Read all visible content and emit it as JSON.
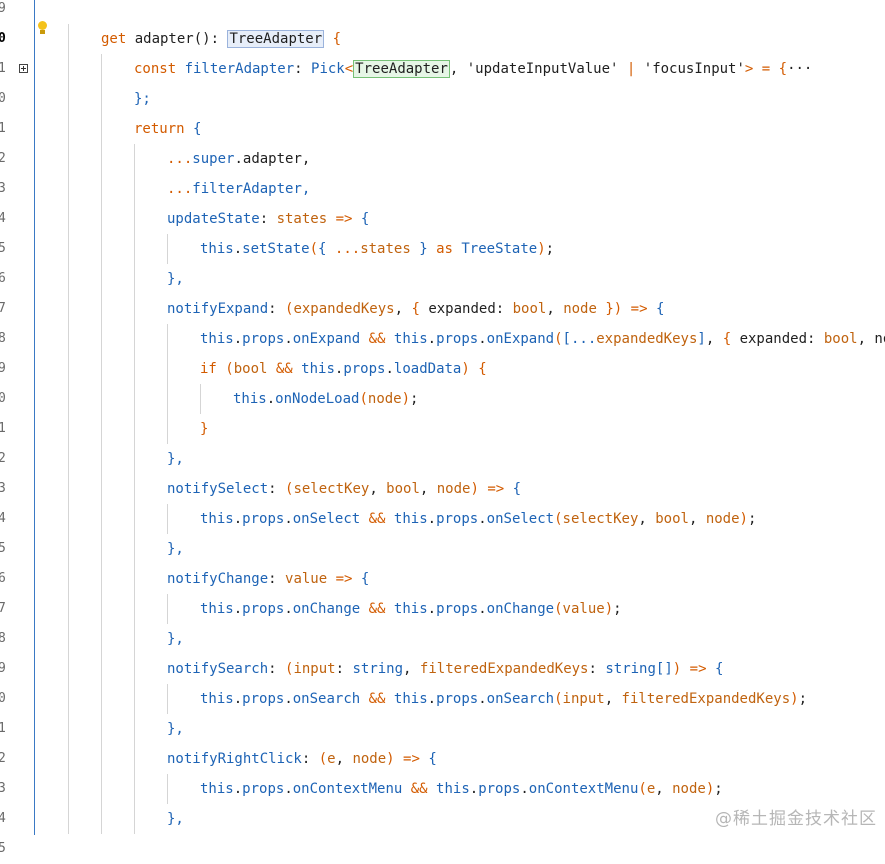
{
  "gutter": {
    "line_numbers": [
      "9",
      "0",
      "1",
      "0",
      "1",
      "2",
      "3",
      "4",
      "5",
      "6",
      "7",
      "8",
      "9",
      "0",
      "1",
      "2",
      "3",
      "4",
      "5",
      "6",
      "7",
      "8",
      "9",
      "0",
      "1",
      "2",
      "3",
      "4",
      "5"
    ],
    "active_index": 1,
    "fold_index": 2,
    "bulb_icon": "lightbulb-icon"
  },
  "code": {
    "lines": [
      [],
      [
        [
          "kw",
          "get "
        ],
        [
          "pl",
          "adapter(): "
        ],
        [
          "box-blue",
          "TreeAdapter"
        ],
        [
          "kw",
          " {"
        ]
      ],
      [
        [
          "kw",
          "const "
        ],
        [
          "fn",
          "filterAdapter"
        ],
        [
          "pl",
          ": "
        ],
        [
          "ty",
          "Pick"
        ],
        [
          "kw",
          "<"
        ],
        [
          "box-green",
          "TreeAdapter"
        ],
        [
          "pl",
          ", 'updateInputValue' "
        ],
        [
          "kw",
          "|"
        ],
        [
          "pl",
          " 'focusInput'"
        ],
        [
          "kw",
          "> = {"
        ],
        [
          "pl",
          "···"
        ]
      ],
      [
        [
          "fn",
          "};"
        ]
      ],
      [
        [
          "kw",
          "return "
        ],
        [
          "fn",
          "{"
        ]
      ],
      [
        [
          "kw",
          "..."
        ],
        [
          "fn",
          "super"
        ],
        [
          "pl",
          "."
        ],
        [
          "pl",
          "adapter,"
        ]
      ],
      [
        [
          "kw",
          "..."
        ],
        [
          "fn",
          "filterAdapter,"
        ]
      ],
      [
        [
          "fn",
          "updateState"
        ],
        [
          "pl",
          ": "
        ],
        [
          "or",
          "states"
        ],
        [
          "kw",
          " => "
        ],
        [
          "fn",
          "{"
        ]
      ],
      [
        [
          "fn",
          "this"
        ],
        [
          "pl",
          "."
        ],
        [
          "fn",
          "setState"
        ],
        [
          "kw",
          "("
        ],
        [
          "fn",
          "{ "
        ],
        [
          "kw",
          "..."
        ],
        [
          "or",
          "states"
        ],
        [
          "fn",
          " } "
        ],
        [
          "kw",
          "as "
        ],
        [
          "ty",
          "TreeState"
        ],
        [
          "kw",
          ")"
        ],
        [
          "pl",
          ";"
        ]
      ],
      [
        [
          "fn",
          "},"
        ]
      ],
      [
        [
          "fn",
          "notifyExpand"
        ],
        [
          "pl",
          ": "
        ],
        [
          "kw",
          "("
        ],
        [
          "or",
          "expandedKeys"
        ],
        [
          "pl",
          ", "
        ],
        [
          "kw",
          "{ "
        ],
        [
          "pl",
          "expanded: "
        ],
        [
          "or",
          "bool"
        ],
        [
          "pl",
          ", "
        ],
        [
          "or",
          "node"
        ],
        [
          "kw",
          " }) => "
        ],
        [
          "fn",
          "{"
        ]
      ],
      [
        [
          "fn",
          "this"
        ],
        [
          "pl",
          "."
        ],
        [
          "fn",
          "props"
        ],
        [
          "pl",
          "."
        ],
        [
          "fn",
          "onExpand"
        ],
        [
          "kw",
          " && "
        ],
        [
          "fn",
          "this"
        ],
        [
          "pl",
          "."
        ],
        [
          "fn",
          "props"
        ],
        [
          "pl",
          "."
        ],
        [
          "fn",
          "onExpand"
        ],
        [
          "kw",
          "("
        ],
        [
          "fn",
          "[..."
        ],
        [
          "or",
          "expandedKeys"
        ],
        [
          "fn",
          "]"
        ],
        [
          "pl",
          ", "
        ],
        [
          "kw",
          "{ "
        ],
        [
          "pl",
          "expanded: "
        ],
        [
          "or",
          "bool"
        ],
        [
          "pl",
          ", node "
        ],
        [
          "kw",
          "})"
        ]
      ],
      [
        [
          "kw",
          "if "
        ],
        [
          "kw",
          "("
        ],
        [
          "or",
          "bool"
        ],
        [
          "kw",
          " && "
        ],
        [
          "fn",
          "this"
        ],
        [
          "pl",
          "."
        ],
        [
          "fn",
          "props"
        ],
        [
          "pl",
          "."
        ],
        [
          "fn",
          "loadData"
        ],
        [
          "kw",
          ") {"
        ]
      ],
      [
        [
          "fn",
          "this"
        ],
        [
          "pl",
          "."
        ],
        [
          "fn",
          "onNodeLoad"
        ],
        [
          "kw",
          "("
        ],
        [
          "or",
          "node"
        ],
        [
          "kw",
          ")"
        ],
        [
          "pl",
          ";"
        ]
      ],
      [
        [
          "kw",
          "}"
        ]
      ],
      [
        [
          "fn",
          "},"
        ]
      ],
      [
        [
          "fn",
          "notifySelect"
        ],
        [
          "pl",
          ": "
        ],
        [
          "kw",
          "("
        ],
        [
          "or",
          "selectKey"
        ],
        [
          "pl",
          ", "
        ],
        [
          "or",
          "bool"
        ],
        [
          "pl",
          ", "
        ],
        [
          "or",
          "node"
        ],
        [
          "kw",
          ") => "
        ],
        [
          "fn",
          "{"
        ]
      ],
      [
        [
          "fn",
          "this"
        ],
        [
          "pl",
          "."
        ],
        [
          "fn",
          "props"
        ],
        [
          "pl",
          "."
        ],
        [
          "fn",
          "onSelect"
        ],
        [
          "kw",
          " && "
        ],
        [
          "fn",
          "this"
        ],
        [
          "pl",
          "."
        ],
        [
          "fn",
          "props"
        ],
        [
          "pl",
          "."
        ],
        [
          "fn",
          "onSelect"
        ],
        [
          "kw",
          "("
        ],
        [
          "or",
          "selectKey"
        ],
        [
          "pl",
          ", "
        ],
        [
          "or",
          "bool"
        ],
        [
          "pl",
          ", "
        ],
        [
          "or",
          "node"
        ],
        [
          "kw",
          ")"
        ],
        [
          "pl",
          ";"
        ]
      ],
      [
        [
          "fn",
          "},"
        ]
      ],
      [
        [
          "fn",
          "notifyChange"
        ],
        [
          "pl",
          ": "
        ],
        [
          "or",
          "value"
        ],
        [
          "kw",
          " => "
        ],
        [
          "fn",
          "{"
        ]
      ],
      [
        [
          "fn",
          "this"
        ],
        [
          "pl",
          "."
        ],
        [
          "fn",
          "props"
        ],
        [
          "pl",
          "."
        ],
        [
          "fn",
          "onChange"
        ],
        [
          "kw",
          " && "
        ],
        [
          "fn",
          "this"
        ],
        [
          "pl",
          "."
        ],
        [
          "fn",
          "props"
        ],
        [
          "pl",
          "."
        ],
        [
          "fn",
          "onChange"
        ],
        [
          "kw",
          "("
        ],
        [
          "or",
          "value"
        ],
        [
          "kw",
          ")"
        ],
        [
          "pl",
          ";"
        ]
      ],
      [
        [
          "fn",
          "},"
        ]
      ],
      [
        [
          "fn",
          "notifySearch"
        ],
        [
          "pl",
          ": "
        ],
        [
          "kw",
          "("
        ],
        [
          "or",
          "input"
        ],
        [
          "pl",
          ": "
        ],
        [
          "fn",
          "string"
        ],
        [
          "pl",
          ", "
        ],
        [
          "or",
          "filteredExpandedKeys"
        ],
        [
          "pl",
          ": "
        ],
        [
          "fn",
          "string[]"
        ],
        [
          "kw",
          ") => "
        ],
        [
          "fn",
          "{"
        ]
      ],
      [
        [
          "fn",
          "this"
        ],
        [
          "pl",
          "."
        ],
        [
          "fn",
          "props"
        ],
        [
          "pl",
          "."
        ],
        [
          "fn",
          "onSearch"
        ],
        [
          "kw",
          " && "
        ],
        [
          "fn",
          "this"
        ],
        [
          "pl",
          "."
        ],
        [
          "fn",
          "props"
        ],
        [
          "pl",
          "."
        ],
        [
          "fn",
          "onSearch"
        ],
        [
          "kw",
          "("
        ],
        [
          "or",
          "input"
        ],
        [
          "pl",
          ", "
        ],
        [
          "or",
          "filteredExpandedKeys"
        ],
        [
          "kw",
          ")"
        ],
        [
          "pl",
          ";"
        ]
      ],
      [
        [
          "fn",
          "},"
        ]
      ],
      [
        [
          "fn",
          "notifyRightClick"
        ],
        [
          "pl",
          ": "
        ],
        [
          "kw",
          "("
        ],
        [
          "or",
          "e"
        ],
        [
          "pl",
          ", "
        ],
        [
          "or",
          "node"
        ],
        [
          "kw",
          ") => "
        ],
        [
          "fn",
          "{"
        ]
      ],
      [
        [
          "fn",
          "this"
        ],
        [
          "pl",
          "."
        ],
        [
          "fn",
          "props"
        ],
        [
          "pl",
          "."
        ],
        [
          "fn",
          "onContextMenu"
        ],
        [
          "kw",
          " && "
        ],
        [
          "fn",
          "this"
        ],
        [
          "pl",
          "."
        ],
        [
          "fn",
          "props"
        ],
        [
          "pl",
          "."
        ],
        [
          "fn",
          "onContextMenu"
        ],
        [
          "kw",
          "("
        ],
        [
          "or",
          "e"
        ],
        [
          "pl",
          ", "
        ],
        [
          "or",
          "node"
        ],
        [
          "kw",
          ")"
        ],
        [
          "pl",
          ";"
        ]
      ],
      [
        [
          "fn",
          "},"
        ]
      ]
    ],
    "indent_levels": [
      0,
      1,
      2,
      2,
      2,
      3,
      3,
      3,
      4,
      3,
      3,
      4,
      4,
      5,
      4,
      3,
      3,
      4,
      3,
      3,
      4,
      3,
      3,
      4,
      3,
      3,
      4,
      3
    ]
  },
  "watermark": "@稀土掘金技术社区"
}
